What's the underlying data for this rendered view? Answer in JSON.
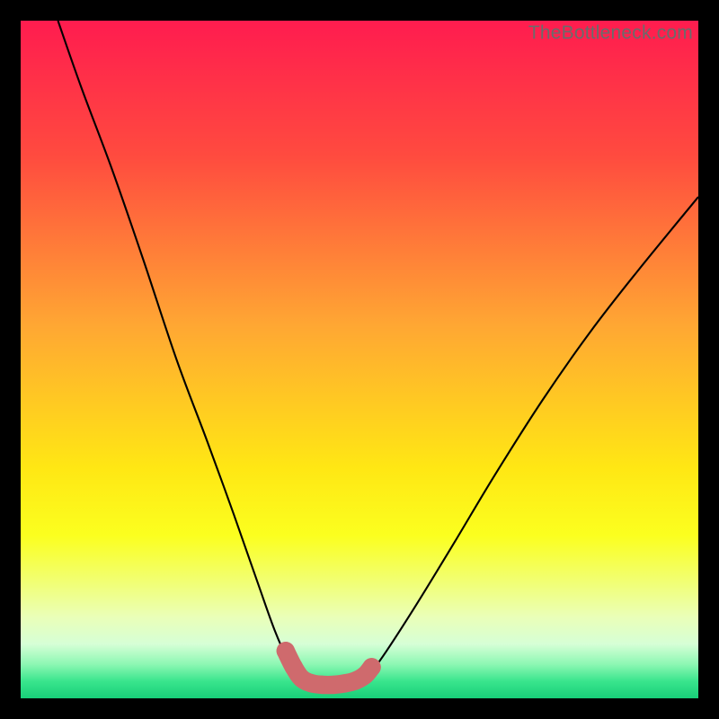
{
  "watermark": "TheBottleneck.com",
  "colors": {
    "black": "#000000",
    "curve": "#000000",
    "marker_fill": "#cf6a6d",
    "marker_stroke": "#cf6a6d"
  },
  "chart_data": {
    "type": "line",
    "title": "",
    "xlabel": "",
    "ylabel": "",
    "xlim": [
      0,
      100
    ],
    "ylim": [
      0,
      100
    ],
    "gradient_stops": [
      {
        "pct": 0,
        "color": "#ff1c4f"
      },
      {
        "pct": 20,
        "color": "#ff4b3f"
      },
      {
        "pct": 45,
        "color": "#ffa733"
      },
      {
        "pct": 66,
        "color": "#ffe714"
      },
      {
        "pct": 76,
        "color": "#fbff1f"
      },
      {
        "pct": 83,
        "color": "#f1ff76"
      },
      {
        "pct": 88,
        "color": "#eaffb8"
      },
      {
        "pct": 92,
        "color": "#d6ffd6"
      },
      {
        "pct": 95,
        "color": "#8cf7b3"
      },
      {
        "pct": 97.5,
        "color": "#39e58d"
      },
      {
        "pct": 100,
        "color": "#18cf78"
      }
    ],
    "series": [
      {
        "name": "left-curve",
        "points": [
          {
            "x": 5.5,
            "y": 100
          },
          {
            "x": 9.0,
            "y": 90
          },
          {
            "x": 13.5,
            "y": 78
          },
          {
            "x": 18.0,
            "y": 65
          },
          {
            "x": 23.0,
            "y": 50
          },
          {
            "x": 27.5,
            "y": 38
          },
          {
            "x": 31.5,
            "y": 27
          },
          {
            "x": 35.0,
            "y": 17
          },
          {
            "x": 37.5,
            "y": 10
          },
          {
            "x": 39.5,
            "y": 5.5
          },
          {
            "x": 41.0,
            "y": 3.0
          }
        ]
      },
      {
        "name": "right-curve",
        "points": [
          {
            "x": 51.5,
            "y": 3.5
          },
          {
            "x": 54.0,
            "y": 7.0
          },
          {
            "x": 58.5,
            "y": 14
          },
          {
            "x": 64.0,
            "y": 23
          },
          {
            "x": 70.0,
            "y": 33
          },
          {
            "x": 77.0,
            "y": 44
          },
          {
            "x": 84.0,
            "y": 54
          },
          {
            "x": 91.0,
            "y": 63
          },
          {
            "x": 100,
            "y": 74
          }
        ]
      },
      {
        "name": "bottom-markers",
        "marker": true,
        "points": [
          {
            "x": 39.1,
            "y": 7.0
          },
          {
            "x": 40.3,
            "y": 4.6
          },
          {
            "x": 41.5,
            "y": 2.9
          },
          {
            "x": 43.0,
            "y": 2.2
          },
          {
            "x": 44.5,
            "y": 2.0
          },
          {
            "x": 46.2,
            "y": 2.0
          },
          {
            "x": 47.8,
            "y": 2.2
          },
          {
            "x": 49.4,
            "y": 2.6
          },
          {
            "x": 50.8,
            "y": 3.4
          },
          {
            "x": 51.8,
            "y": 4.6
          }
        ]
      }
    ]
  }
}
